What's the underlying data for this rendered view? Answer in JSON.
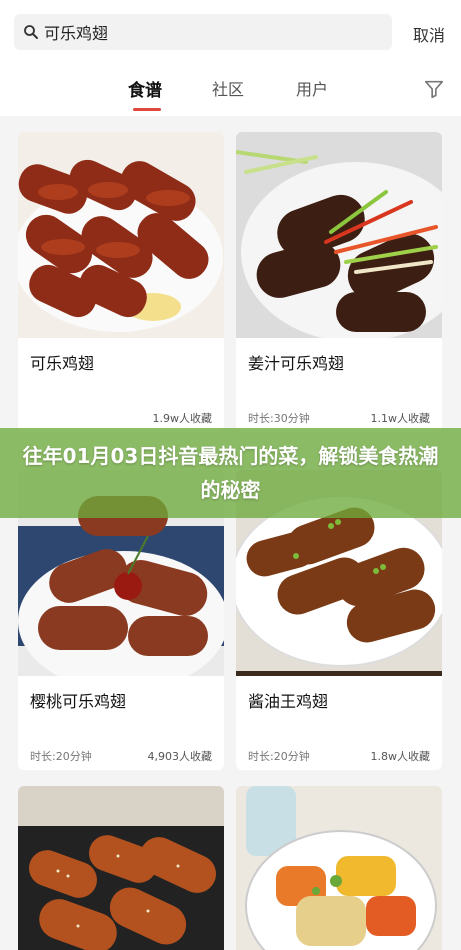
{
  "search": {
    "query": "可乐鸡翅",
    "cancel_label": "取消"
  },
  "tabs": [
    {
      "label": "食谱"
    },
    {
      "label": "社区"
    },
    {
      "label": "用户"
    }
  ],
  "cards": [
    {
      "title": "可乐鸡翅",
      "time": "",
      "favorites": "1.9w人收藏"
    },
    {
      "title": "姜汁可乐鸡翅",
      "time": "时长:30分钟",
      "favorites": "1.1w人收藏"
    },
    {
      "title": "樱桃可乐鸡翅",
      "time": "时长:20分钟",
      "favorites": "4,903人收藏"
    },
    {
      "title": "酱油王鸡翅",
      "time": "时长:20分钟",
      "favorites": "1.8w人收藏"
    },
    {
      "title": "",
      "time": "",
      "favorites": ""
    },
    {
      "title": "",
      "time": "",
      "favorites": ""
    }
  ],
  "banner": {
    "text": "往年01月03日抖音最热门的菜，解锁美食热潮的秘密"
  },
  "colors": {
    "accent": "#e0463c",
    "banner": "#6eaa3c"
  },
  "icons": [
    "search-icon",
    "filter-icon"
  ]
}
